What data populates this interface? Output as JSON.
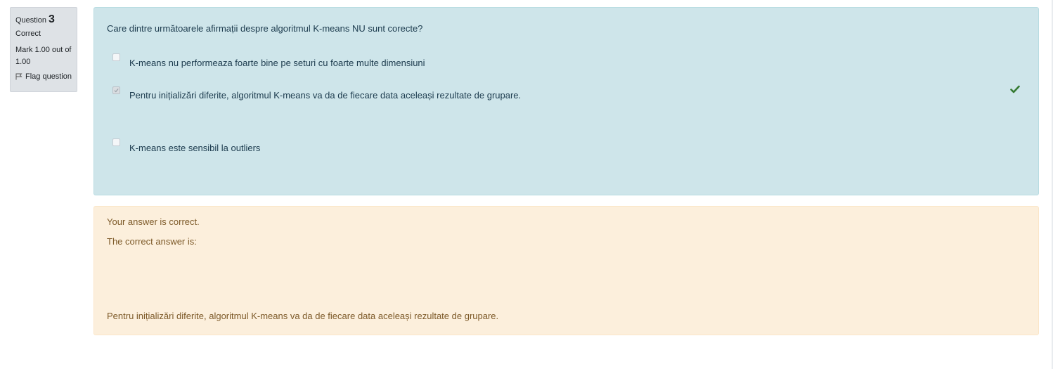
{
  "info": {
    "question_label": "Question",
    "question_number": "3",
    "state": "Correct",
    "grade": "Mark 1.00 out of 1.00",
    "flag_label": "Flag question"
  },
  "question": {
    "text": "Care dintre următoarele afirmații despre algoritmul K-means NU sunt corecte?",
    "answers": [
      {
        "text": "K-means nu performeaza foarte bine pe seturi cu foarte multe dimensiuni",
        "checked": false
      },
      {
        "text": "Pentru inițializări diferite, algoritmul K-means va da de fiecare data aceleași rezultate de grupare.",
        "checked": true,
        "correct": true
      },
      {
        "text": "K-means este sensibil la outliers",
        "checked": false
      }
    ]
  },
  "feedback": {
    "general": "Your answer is correct.",
    "right_answer_label": "The correct answer is:",
    "right_answer": "Pentru inițializări diferite, algoritmul K-means va da de fiecare data aceleași rezultate de grupare."
  },
  "colors": {
    "formulation_bg": "#cee5ea",
    "feedback_bg": "#fcefdc",
    "info_bg": "#dee2e6",
    "correct_green": "#357a32"
  }
}
